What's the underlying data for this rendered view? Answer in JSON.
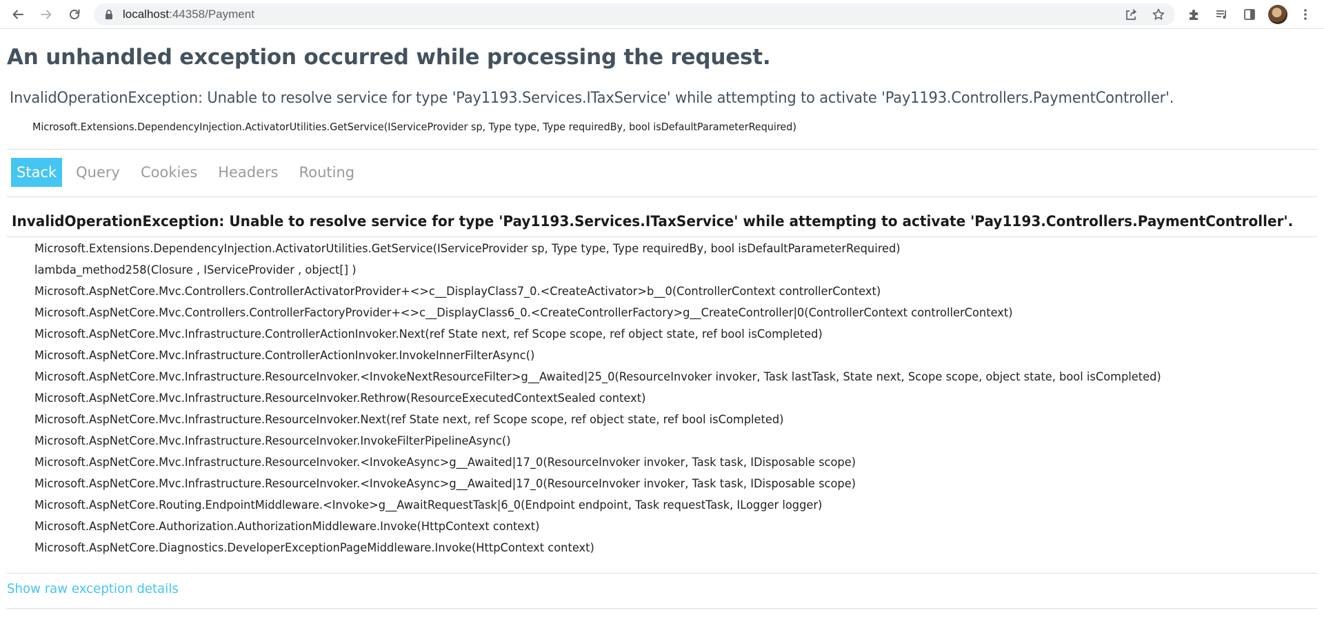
{
  "browser": {
    "url_host": "localhost",
    "url_port_path": ":44358/Payment",
    "icons": {
      "back": "arrow-left-icon",
      "forward": "arrow-right-icon",
      "reload": "reload-icon",
      "lock": "lock-icon",
      "share": "share-icon",
      "bookmark": "star-icon",
      "extensions": "puzzle-icon",
      "media": "media-queue-icon",
      "sidepanel": "side-panel-icon",
      "menu": "kebab-menu-icon"
    }
  },
  "page": {
    "title": "An unhandled exception occurred while processing the request.",
    "summary": "InvalidOperationException: Unable to resolve service for type 'Pay1193.Services.ITaxService' while attempting to activate 'Pay1193.Controllers.PaymentController'.",
    "location": "Microsoft.Extensions.DependencyInjection.ActivatorUtilities.GetService(IServiceProvider sp, Type type, Type requiredBy, bool isDefaultParameterRequired)",
    "tabs": [
      {
        "label": "Stack",
        "active": true
      },
      {
        "label": "Query",
        "active": false
      },
      {
        "label": "Cookies",
        "active": false
      },
      {
        "label": "Headers",
        "active": false
      },
      {
        "label": "Routing",
        "active": false
      }
    ],
    "stack_heading": "InvalidOperationException: Unable to resolve service for type 'Pay1193.Services.ITaxService' while attempting to activate 'Pay1193.Controllers.PaymentController'.",
    "frames": [
      "Microsoft.Extensions.DependencyInjection.ActivatorUtilities.GetService(IServiceProvider sp, Type type, Type requiredBy, bool isDefaultParameterRequired)",
      "lambda_method258(Closure , IServiceProvider , object[] )",
      "Microsoft.AspNetCore.Mvc.Controllers.ControllerActivatorProvider+<>c__DisplayClass7_0.<CreateActivator>b__0(ControllerContext controllerContext)",
      "Microsoft.AspNetCore.Mvc.Controllers.ControllerFactoryProvider+<>c__DisplayClass6_0.<CreateControllerFactory>g__CreateController|0(ControllerContext controllerContext)",
      "Microsoft.AspNetCore.Mvc.Infrastructure.ControllerActionInvoker.Next(ref State next, ref Scope scope, ref object state, ref bool isCompleted)",
      "Microsoft.AspNetCore.Mvc.Infrastructure.ControllerActionInvoker.InvokeInnerFilterAsync()",
      "Microsoft.AspNetCore.Mvc.Infrastructure.ResourceInvoker.<InvokeNextResourceFilter>g__Awaited|25_0(ResourceInvoker invoker, Task lastTask, State next, Scope scope, object state, bool isCompleted)",
      "Microsoft.AspNetCore.Mvc.Infrastructure.ResourceInvoker.Rethrow(ResourceExecutedContextSealed context)",
      "Microsoft.AspNetCore.Mvc.Infrastructure.ResourceInvoker.Next(ref State next, ref Scope scope, ref object state, ref bool isCompleted)",
      "Microsoft.AspNetCore.Mvc.Infrastructure.ResourceInvoker.InvokeFilterPipelineAsync()",
      "Microsoft.AspNetCore.Mvc.Infrastructure.ResourceInvoker.<InvokeAsync>g__Awaited|17_0(ResourceInvoker invoker, Task task, IDisposable scope)",
      "Microsoft.AspNetCore.Mvc.Infrastructure.ResourceInvoker.<InvokeAsync>g__Awaited|17_0(ResourceInvoker invoker, Task task, IDisposable scope)",
      "Microsoft.AspNetCore.Routing.EndpointMiddleware.<Invoke>g__AwaitRequestTask|6_0(Endpoint endpoint, Task requestTask, ILogger logger)",
      "Microsoft.AspNetCore.Authorization.AuthorizationMiddleware.Invoke(HttpContext context)",
      "Microsoft.AspNetCore.Diagnostics.DeveloperExceptionPageMiddleware.Invoke(HttpContext context)"
    ],
    "raw_link": "Show raw exception details",
    "colors": {
      "accent": "#44c5f2",
      "heading": "#44525e",
      "tab_inactive": "#9a9a9a"
    }
  }
}
